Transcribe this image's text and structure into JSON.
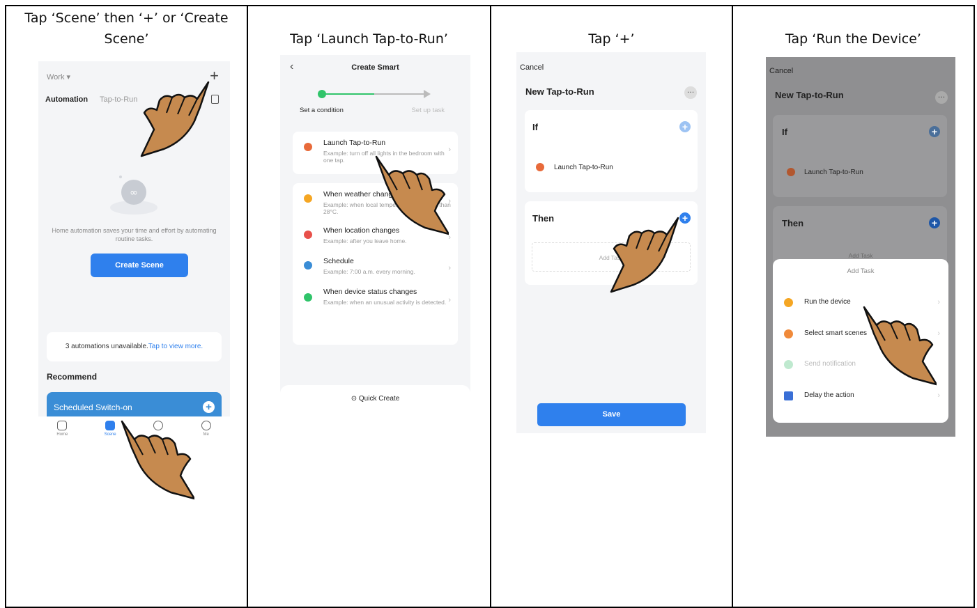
{
  "colors": {
    "accent": "#2f80ed",
    "green": "#30c46a",
    "hand": "#c68a4f",
    "hand_outline": "#111111"
  },
  "captions": [
    "Tap ‘Scene’ then ‘+’ or ‘Create Scene’",
    "Tap ‘Launch Tap-to-Run’",
    "Tap ‘+’",
    "Tap ‘Run the Device’"
  ],
  "screen1": {
    "home_name": "Work ▾",
    "add_icon": "plus-icon",
    "tabs": {
      "automation": "Automation",
      "tap_to_run": "Tap-to-Run"
    },
    "empty_text": "Home automation saves your time and effort by automating routine tasks.",
    "create_button": "Create Scene",
    "unavailable_text": "3 automations unavailable.",
    "unavailable_link": "Tap to view more.",
    "recommend": "Recommend",
    "scheduled": "Scheduled Switch-on",
    "tabbar": {
      "home": "Home",
      "scene": "Scene",
      "smart": "",
      "me": "Me"
    }
  },
  "screen2": {
    "title": "Create Smart",
    "step1": "Set a condition",
    "step2": "Set up task",
    "conditions": [
      {
        "title": "Launch Tap-to-Run",
        "desc": "Example: turn off all lights in the bedroom with one tap.",
        "icon": "hand-tap-icon",
        "color": "#e86a3a"
      },
      {
        "title": "When weather changes",
        "desc": "Example: when local temperature is greater than 28°C.",
        "icon": "sun-icon",
        "color": "#f5a623"
      },
      {
        "title": "When location changes",
        "desc": "Example: after you leave home.",
        "icon": "location-pin-icon",
        "color": "#e8504a"
      },
      {
        "title": "Schedule",
        "desc": "Example: 7:00 a.m. every morning.",
        "icon": "clock-icon",
        "color": "#3a8dd6"
      },
      {
        "title": "When device status changes",
        "desc": "Example: when an unusual activity is detected.",
        "icon": "device-icon",
        "color": "#30c46a"
      }
    ],
    "quick_create": "Quick Create"
  },
  "screen3": {
    "cancel": "Cancel",
    "title": "New Tap-to-Run",
    "if_label": "If",
    "condition": "Launch Tap-to-Run",
    "then_label": "Then",
    "add_task": "Add Task",
    "save": "Save"
  },
  "screen4": {
    "cancel": "Cancel",
    "title": "New Tap-to-Run",
    "if_label": "If",
    "condition": "Launch Tap-to-Run",
    "then_label": "Then",
    "add_task_behind": "Add Task",
    "sheet_title": "Add Task",
    "options": [
      {
        "label": "Run the device",
        "icon": "sun-icon",
        "color": "#f5a623",
        "dim": false
      },
      {
        "label": "Select smart scenes",
        "icon": "sunrise-icon",
        "color": "#f08a3a",
        "dim": false
      },
      {
        "label": "Send notification",
        "icon": "message-icon",
        "color": "#bfe9cf",
        "dim": true
      },
      {
        "label": "Delay the action",
        "icon": "hourglass-icon",
        "color": "#3a6fd6",
        "dim": false
      }
    ]
  }
}
